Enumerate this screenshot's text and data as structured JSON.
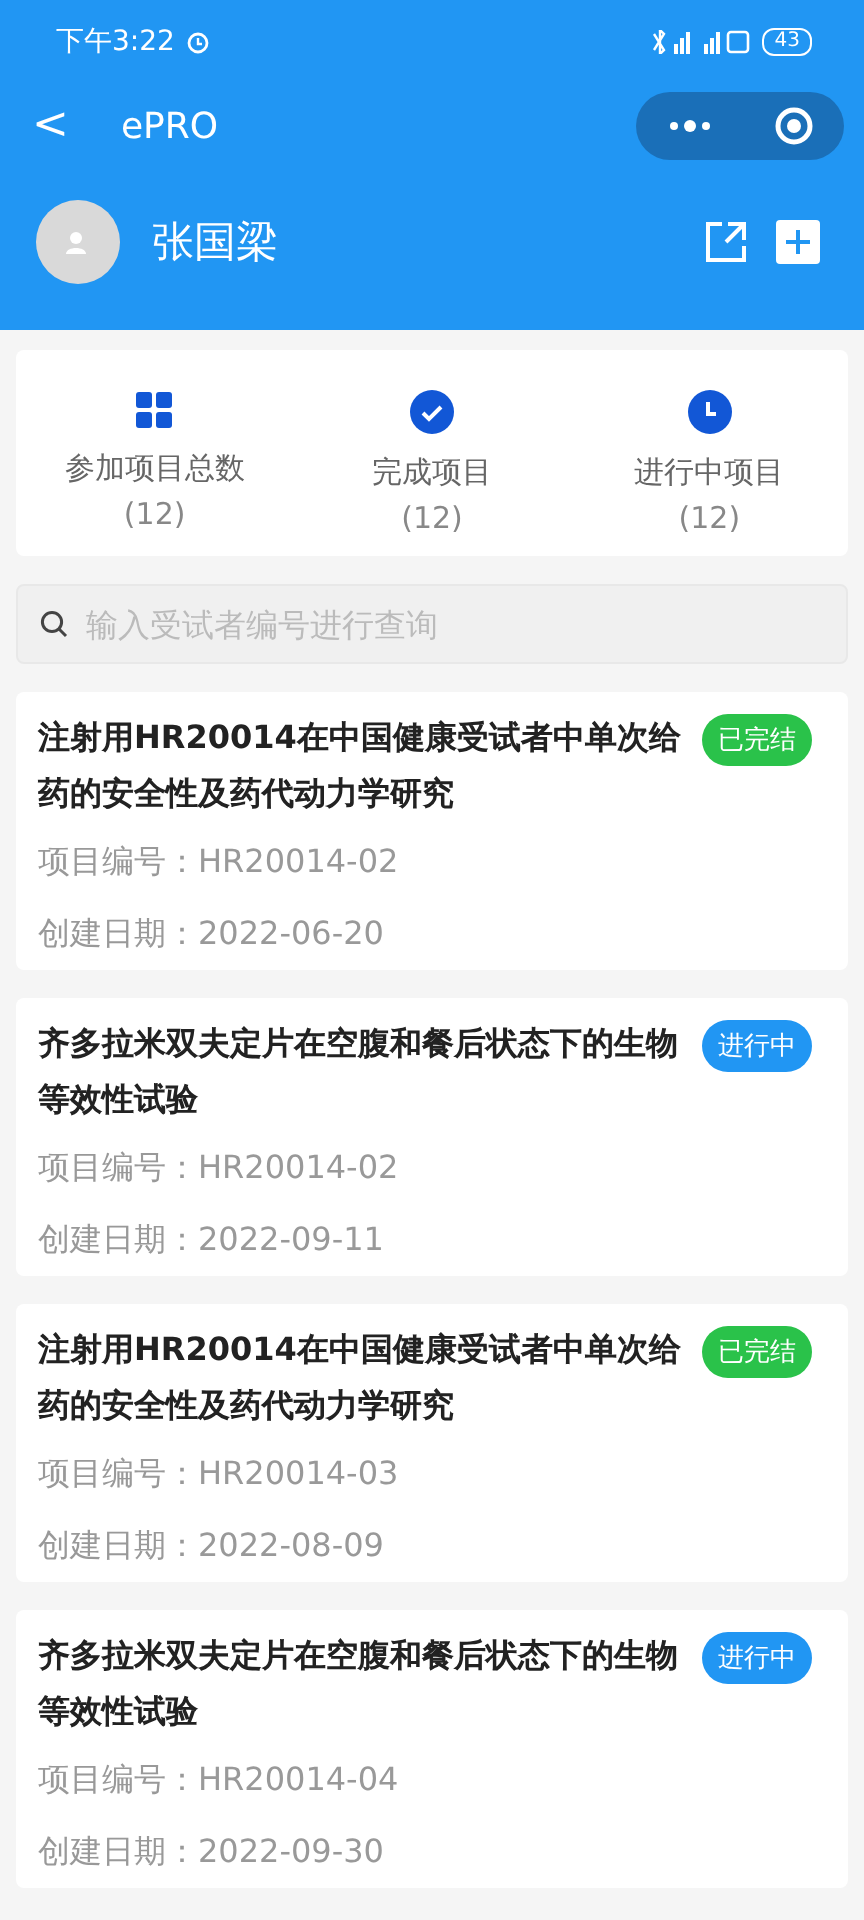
{
  "status_bar": {
    "time": "下午3:22",
    "battery": "43"
  },
  "nav": {
    "back": "<",
    "title": "ePRO"
  },
  "user": {
    "name": "张国梁"
  },
  "stats": [
    {
      "kind": "grid",
      "label": "参加项目总数",
      "count": "(12)"
    },
    {
      "kind": "check",
      "label": "完成项目",
      "count": "(12)"
    },
    {
      "kind": "clock",
      "label": "进行中项目",
      "count": "(12)"
    }
  ],
  "search": {
    "placeholder": "输入受试者编号进行查询"
  },
  "projects": [
    {
      "title": "注射用HR20014在中国健康受试者中单次给药的安全性及药代动力学研究",
      "status": {
        "kind": "done",
        "label": "已完结"
      },
      "code": "项目编号：HR20014-02",
      "date": "创建日期：2022-06-20"
    },
    {
      "title": "齐多拉米双夫定片在空腹和餐后状态下的生物等效性试验",
      "status": {
        "kind": "ongoing",
        "label": "进行中"
      },
      "code": "项目编号：HR20014-02",
      "date": "创建日期：2022-09-11"
    },
    {
      "title": "注射用HR20014在中国健康受试者中单次给药的安全性及药代动力学研究",
      "status": {
        "kind": "done",
        "label": "已完结"
      },
      "code": "项目编号：HR20014-03",
      "date": "创建日期：2022-08-09"
    },
    {
      "title": "齐多拉米双夫定片在空腹和餐后状态下的生物等效性试验",
      "status": {
        "kind": "ongoing",
        "label": "进行中"
      },
      "code": "项目编号：HR20014-04",
      "date": "创建日期：2022-09-30"
    }
  ]
}
